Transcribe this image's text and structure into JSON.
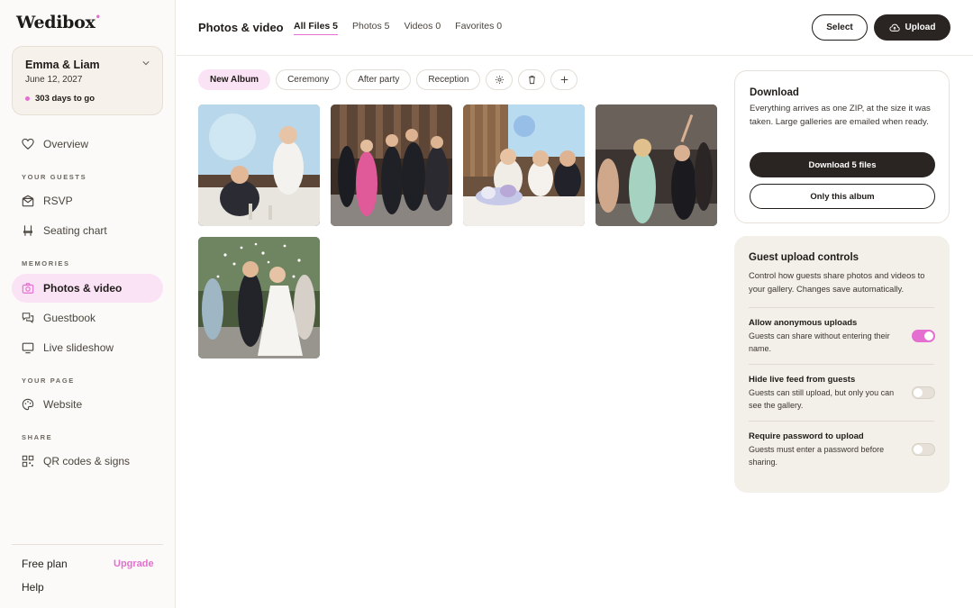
{
  "brand": {
    "logo": "Wedibox",
    "accent": "#e46fd0"
  },
  "event": {
    "name": "Emma & Liam",
    "date": "June 12, 2027",
    "countdown": "303 days to go"
  },
  "nav": {
    "overview": "Overview",
    "guests_label": "YOUR GUESTS",
    "rsvp": "RSVP",
    "seating": "Seating chart",
    "memories_label": "MEMORIES",
    "photos": "Photos & video",
    "guestbook": "Guestbook",
    "slideshow": "Live slideshow",
    "page_label": "YOUR PAGE",
    "website": "Website",
    "share_label": "SHARE",
    "qr": "QR codes & signs"
  },
  "plan": {
    "name": "Free plan",
    "upgrade": "Upgrade",
    "help": "Help"
  },
  "header": {
    "title": "Photos & video",
    "tabs": [
      "All Files 5",
      "Photos 5",
      "Videos 0",
      "Favorites 0"
    ],
    "select_label": "Select",
    "upload_label": "Upload"
  },
  "albums": {
    "new": "New Album",
    "items": [
      "Ceremony",
      "After party",
      "Reception"
    ]
  },
  "download": {
    "title": "Download",
    "description": "Everything arrives as one ZIP, at the size it was taken. Large galleries are emailed when ready.",
    "primary": "Download 5 files",
    "secondary": "Only this album"
  },
  "controls": {
    "title": "Guest upload controls",
    "description": "Control how guests share photos and videos to your gallery. Changes save automatically.",
    "rows": [
      {
        "title": "Allow anonymous uploads",
        "desc": "Guests can share without entering their name.",
        "on": true
      },
      {
        "title": "Hide live feed from guests",
        "desc": "Guests can still upload, but only you can see the gallery.",
        "on": false
      },
      {
        "title": "Require password to upload",
        "desc": "Guests must enter a password before sharing.",
        "on": false
      }
    ]
  }
}
